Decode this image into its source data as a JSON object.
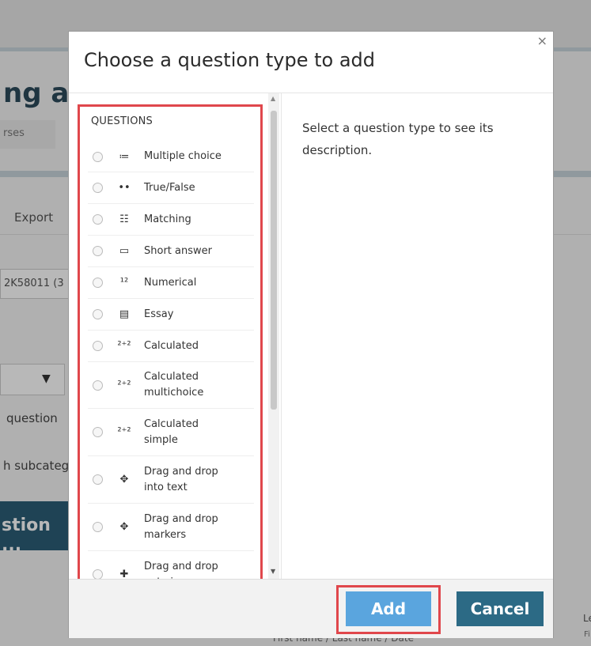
{
  "background": {
    "course_title": "ng ar",
    "breadcrumb": "rses",
    "export_tab": "Export",
    "course_code": "2K58011 (3",
    "select_arrow": "▼",
    "question_text": "question",
    "subcategory_text": "h subcateg",
    "create_button": "stion ...",
    "footer_text": "First name / Last name / Date",
    "right_label_1": "Le",
    "right_label_2": "Fi"
  },
  "modal": {
    "title": "Choose a question type to add",
    "close": "×",
    "section_heading": "QUESTIONS",
    "description": "Select a question type to see its description.",
    "question_types": [
      {
        "label": "Multiple choice",
        "icon": "≔"
      },
      {
        "label": "True/False",
        "icon": "••"
      },
      {
        "label": "Matching",
        "icon": "☷"
      },
      {
        "label": "Short answer",
        "icon": "▭"
      },
      {
        "label": "Numerical",
        "icon": "¹²"
      },
      {
        "label": "Essay",
        "icon": "▤"
      },
      {
        "label": "Calculated",
        "icon": "²⁺²"
      },
      {
        "label": "Calculated multichoice",
        "icon": "²⁺²"
      },
      {
        "label": "Calculated simple",
        "icon": "²⁺²"
      },
      {
        "label": "Drag and drop into text",
        "icon": "✥"
      },
      {
        "label": "Drag and drop markers",
        "icon": "✥"
      },
      {
        "label": "Drag and drop onto image",
        "icon": "✚"
      }
    ],
    "buttons": {
      "add": "Add",
      "cancel": "Cancel"
    }
  },
  "colors": {
    "highlight": "#e0474c",
    "add_button": "#5aa5de",
    "cancel_button": "#2c6a85"
  }
}
